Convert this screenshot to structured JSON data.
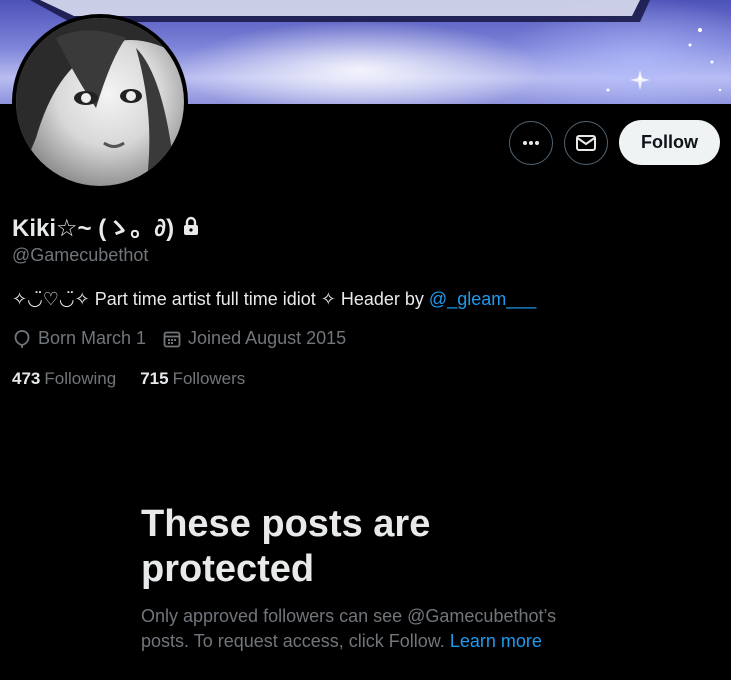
{
  "profile": {
    "display_name": "Kiki☆~ (ゝ。∂)",
    "handle": "@Gamecubethot",
    "bio_text": "✧◡̈♡◡̈✧ Part time artist full time idiot ✧ Header by ",
    "bio_link": "@_gleam___",
    "born": "Born March 1",
    "joined": "Joined August 2015",
    "following_count": "473",
    "following_label": "Following",
    "followers_count": "715",
    "followers_label": "Followers"
  },
  "actions": {
    "more_icon": "more-icon",
    "message_icon": "envelope-icon",
    "follow_label": "Follow"
  },
  "protected": {
    "heading": "These posts are protected",
    "body": "Only approved followers can see @Gamecubethot’s posts. To request access, click Follow.",
    "learn_more": "Learn more"
  },
  "colors": {
    "background": "#000000",
    "text_primary": "#e7e9ea",
    "text_secondary": "#71767b",
    "link": "#1d9bf0",
    "follow_button_bg": "#eff3f4"
  }
}
